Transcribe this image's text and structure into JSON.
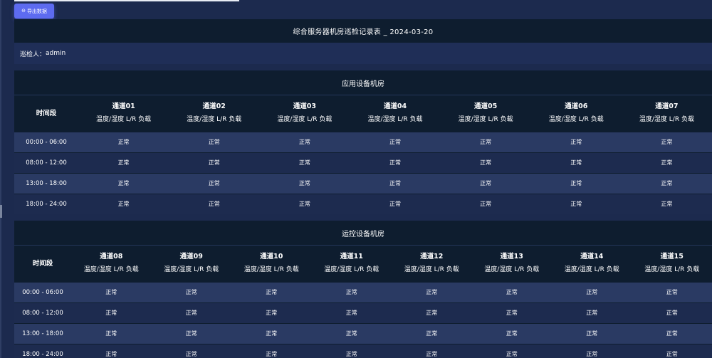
{
  "toolbar": {
    "export_label": "导出数据",
    "export_icon": "export-icon"
  },
  "report": {
    "title": "综合服务器机房巡检记录表 _ 2024-03-20"
  },
  "inspector": {
    "label": "巡检人：",
    "name": "admin"
  },
  "sections": [
    {
      "title": "应用设备机房",
      "time_header": "时间段",
      "channels": [
        "通道01",
        "通道02",
        "通道03",
        "通道04",
        "通道05",
        "通道06",
        "通道07"
      ],
      "sub_header": "温度/湿度 L/R 负载",
      "rows": [
        {
          "time": "00:00 - 06:00",
          "values": [
            "正常",
            "正常",
            "正常",
            "正常",
            "正常",
            "正常",
            "正常"
          ]
        },
        {
          "time": "08:00 - 12:00",
          "values": [
            "正常",
            "正常",
            "正常",
            "正常",
            "正常",
            "正常",
            "正常"
          ]
        },
        {
          "time": "13:00 - 18:00",
          "values": [
            "正常",
            "正常",
            "正常",
            "正常",
            "正常",
            "正常",
            "正常"
          ]
        },
        {
          "time": "18:00 - 24:00",
          "values": [
            "正常",
            "正常",
            "正常",
            "正常",
            "正常",
            "正常",
            "正常"
          ]
        }
      ]
    },
    {
      "title": "运控设备机房",
      "time_header": "时间段",
      "channels": [
        "通道08",
        "通道09",
        "通道10",
        "通道11",
        "通道12",
        "通道13",
        "通道14",
        "通道15"
      ],
      "sub_header": "温度/湿度 L/R 负载",
      "rows": [
        {
          "time": "00:00 - 06:00",
          "values": [
            "正常",
            "正常",
            "正常",
            "正常",
            "正常",
            "正常",
            "正常",
            "正常"
          ]
        },
        {
          "time": "08:00 - 12:00",
          "values": [
            "正常",
            "正常",
            "正常",
            "正常",
            "正常",
            "正常",
            "正常",
            "正常"
          ]
        },
        {
          "time": "13:00 - 18:00",
          "values": [
            "正常",
            "正常",
            "正常",
            "正常",
            "正常",
            "正常",
            "正常",
            "正常"
          ]
        },
        {
          "time": "18:00 - 24:00",
          "values": [
            "正常",
            "正常",
            "正常",
            "正常",
            "正常",
            "正常",
            "正常",
            "正常"
          ]
        }
      ]
    }
  ]
}
